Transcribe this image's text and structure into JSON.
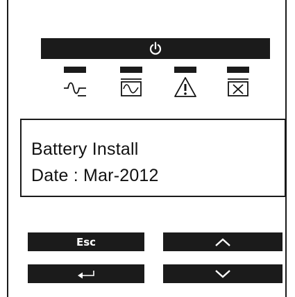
{
  "front_panel": {
    "power_button_icon": "power-icon",
    "indicators": [
      {
        "name": "line-mode",
        "icon": "ac-line-icon"
      },
      {
        "name": "battery-mode",
        "icon": "battery-icon"
      },
      {
        "name": "fault",
        "icon": "warning-icon"
      },
      {
        "name": "battery-fault",
        "icon": "battery-x-icon"
      }
    ]
  },
  "lcd": {
    "line1": "Battery Install",
    "line2": "Date : Mar-2012"
  },
  "keys": {
    "esc_label": "Esc",
    "up_icon": "chevron-up-icon",
    "enter_icon": "enter-arrow-icon",
    "down_icon": "chevron-down-icon"
  },
  "colors": {
    "panel_dark": "#1b1b1b",
    "background": "#ffffff"
  }
}
